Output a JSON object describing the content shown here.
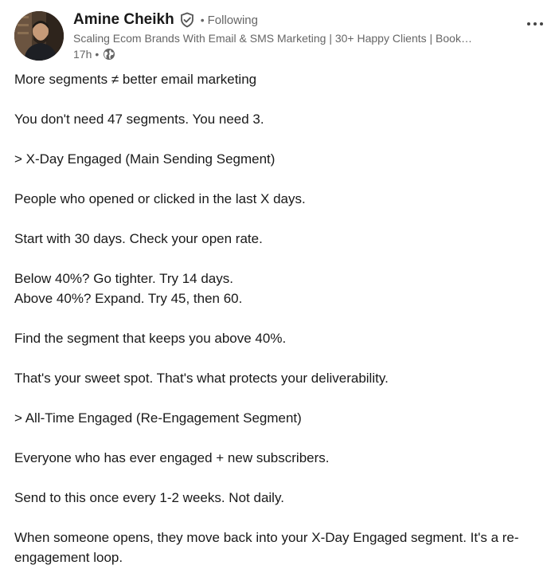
{
  "author": {
    "name": "Amine Cheikh",
    "follow_status": "Following",
    "headline": "Scaling Ecom Brands With Email & SMS Marketing | 30+ Happy Clients | Book…",
    "time": "17h",
    "separator": "•",
    "avatar_icon": "profile-photo",
    "verified_icon": "verified-shield-icon",
    "visibility_icon": "globe-icon"
  },
  "menu": {
    "more_label": "···"
  },
  "colors": {
    "text": "#191919",
    "secondary": "#666666",
    "background": "#ffffff"
  },
  "post": {
    "paragraphs": [
      [
        "More segments ≠ better email marketing"
      ],
      [
        "You don't need 47 segments. You need 3."
      ],
      [
        "> X-Day Engaged (Main Sending Segment)"
      ],
      [
        "People who opened or clicked in the last X days."
      ],
      [
        "Start with 30 days. Check your open rate."
      ],
      [
        "Below 40%? Go tighter. Try 14 days.",
        "Above 40%? Expand. Try 45, then 60."
      ],
      [
        "Find the segment that keeps you above 40%."
      ],
      [
        "That's your sweet spot. That's what protects your deliverability."
      ],
      [
        "> All-Time Engaged (Re-Engagement Segment)"
      ],
      [
        "Everyone who has ever engaged + new subscribers."
      ],
      [
        "Send to this once every 1-2 weeks. Not daily."
      ],
      [
        "When someone opens, they move back into your X-Day Engaged segment. It's a re-engagement loop."
      ]
    ]
  }
}
